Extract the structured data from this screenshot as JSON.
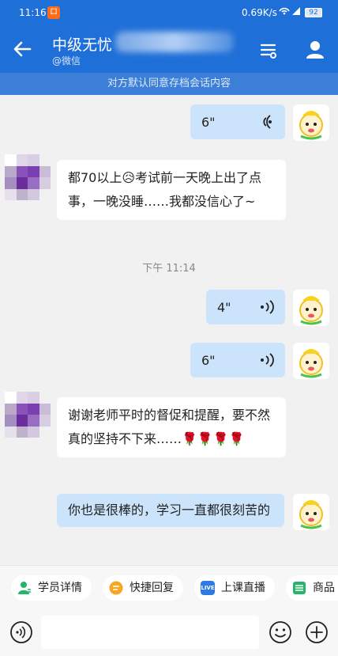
{
  "status_bar": {
    "time": "11:16",
    "notification_glyph": "ロ",
    "speed": "0.69K/s",
    "signal_icons": "⦻ ▾ ▮",
    "battery": "92"
  },
  "header": {
    "title": "中级无忧",
    "subtitle": "@微信"
  },
  "notice": "对方默认同意存档会话内容",
  "messages": {
    "m1": {
      "duration": "6\""
    },
    "m2": {
      "text": "都70以上😥考试前一天晚上出了点事，一晚没睡……我都没信心了~"
    },
    "timestamp": "下午 11:14",
    "m3": {
      "duration": "4\""
    },
    "m4": {
      "duration": "6\""
    },
    "m5": {
      "text": "谢谢老师平时的督促和提醒，要不然真的坚持不下来……🌹🌹🌹🌹"
    },
    "m6": {
      "text": "你也是很棒的，学习一直都很刻苦的"
    }
  },
  "quick_actions": {
    "student_details": "学员详情",
    "quick_reply": "快捷回复",
    "live_class": "上课直播",
    "live_badge": "LIVE",
    "products": "商品"
  },
  "input": {
    "placeholder": ""
  },
  "colors": {
    "header_blue": "#1f6fd8",
    "notice_blue": "#3b7fd9",
    "outgoing_bubble": "#cce4fb",
    "incoming_bubble": "#ffffff",
    "student_icon": "#27b36a",
    "reply_icon": "#f5a623",
    "live_icon": "#2d7be0",
    "product_icon": "#27b36a"
  }
}
